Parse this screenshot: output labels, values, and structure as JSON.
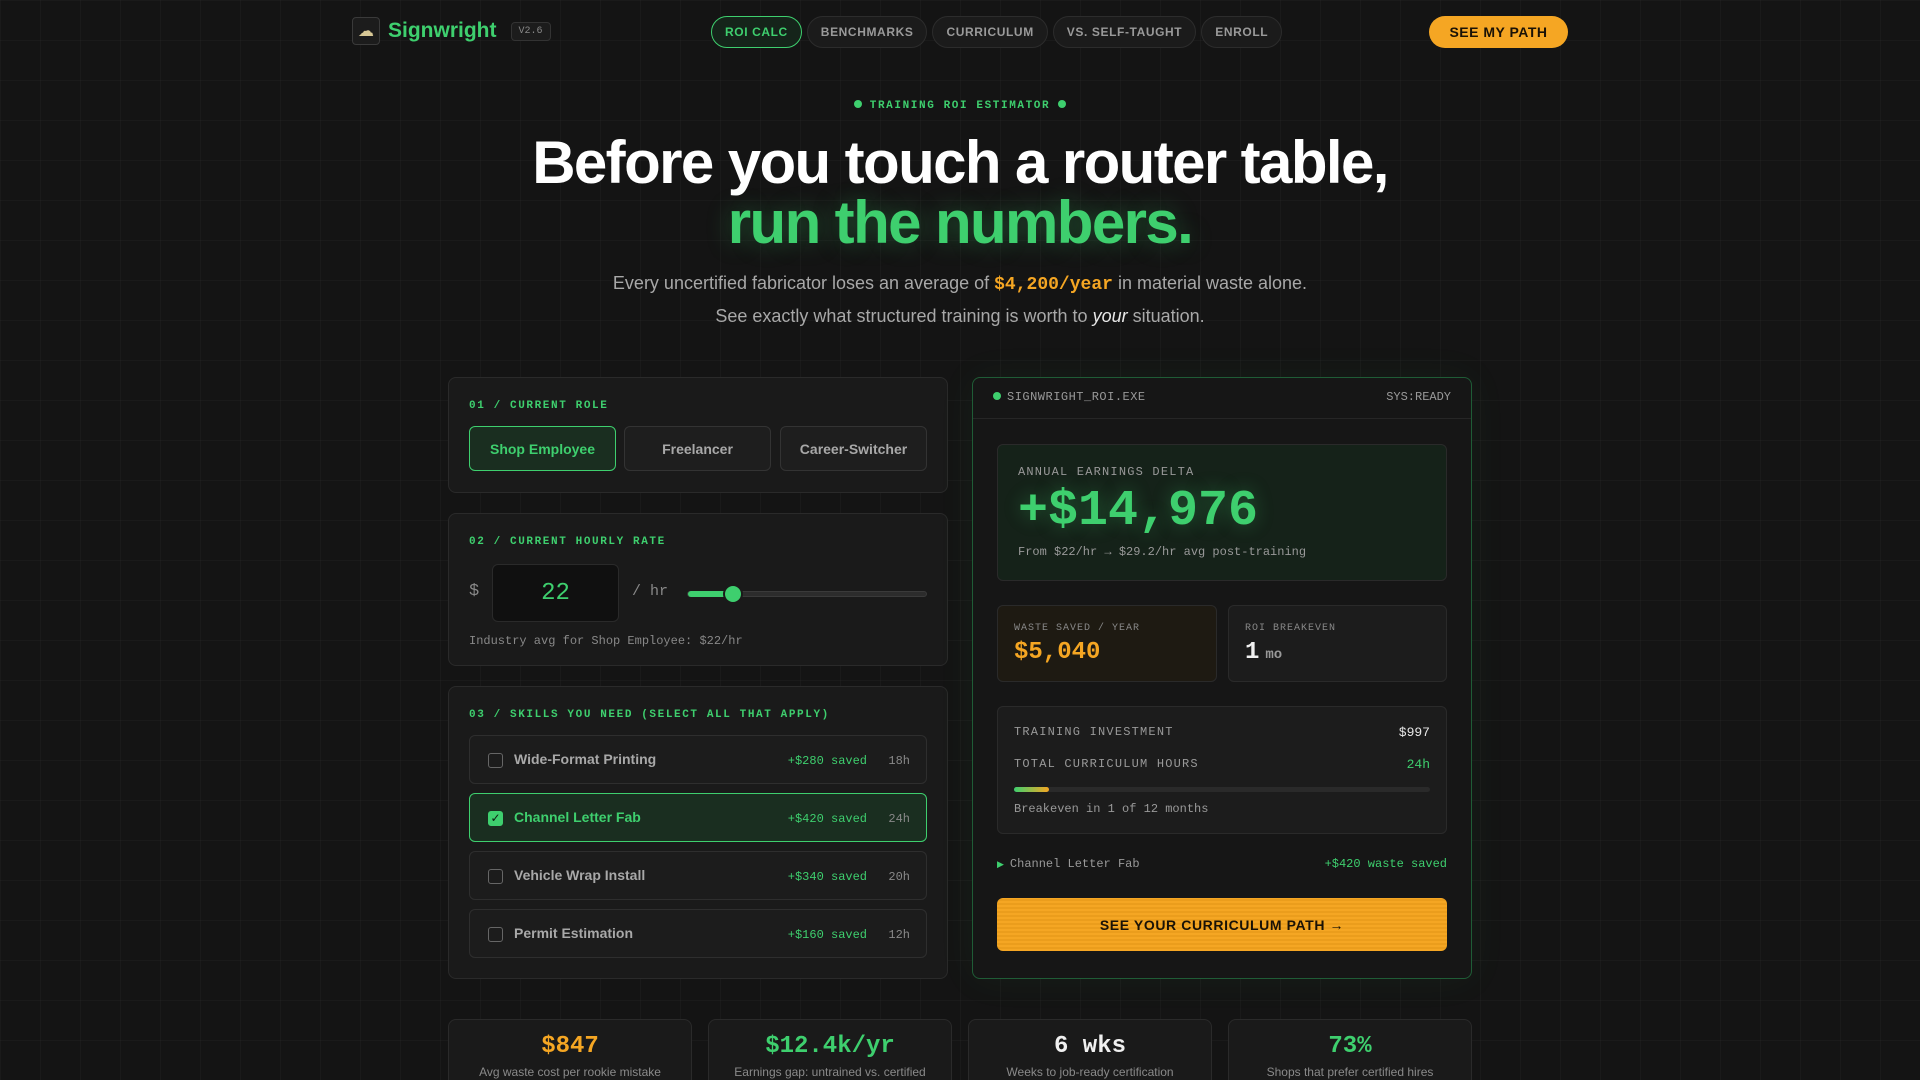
{
  "nav": {
    "brand": "Signwright",
    "version": "V2.6",
    "tabs": [
      "ROI CALC",
      "BENCHMARKS",
      "CURRICULUM",
      "VS. SELF-TAUGHT",
      "ENROLL"
    ],
    "cta": "SEE MY PATH"
  },
  "hero": {
    "eyebrow": "TRAINING ROI ESTIMATOR",
    "headline_1": "Before you touch a router table,",
    "headline_2": "run the numbers.",
    "sub_pre": "Every uncertified fabricator loses an average of ",
    "sub_highlight": "$4,200/year",
    "sub_mid": " in material waste alone. See exactly what structured training is worth to ",
    "sub_em": "your",
    "sub_post": " situation."
  },
  "role": {
    "label": "01 / CURRENT ROLE",
    "options": [
      "Shop Employee",
      "Freelancer",
      "Career-Switcher"
    ],
    "selected": "Shop Employee"
  },
  "rate": {
    "label": "02 / CURRENT HOURLY RATE",
    "currency": "$",
    "value": "22",
    "unit": "/ hr",
    "slider_fraction": 0.19,
    "note": "Industry avg for Shop Employee: $22/hr"
  },
  "skills": {
    "label": "03 / SKILLS YOU NEED (SELECT ALL THAT APPLY)",
    "items": [
      {
        "name": "Wide-Format Printing",
        "saved": "+$280 saved",
        "hours": "18h",
        "checked": false
      },
      {
        "name": "Channel Letter Fab",
        "saved": "+$420 saved",
        "hours": "24h",
        "checked": true
      },
      {
        "name": "Vehicle Wrap Install",
        "saved": "+$340 saved",
        "hours": "20h",
        "checked": false
      },
      {
        "name": "Permit Estimation",
        "saved": "+$160 saved",
        "hours": "12h",
        "checked": false
      }
    ]
  },
  "terminal": {
    "title": "SIGNWRIGHT_ROI.EXE",
    "status": "SYS:READY",
    "delta_label": "ANNUAL EARNINGS DELTA",
    "delta_value": "+$14,976",
    "delta_sub": "From $22/hr → $29.2/hr avg post-training",
    "waste_label": "WASTE SAVED / YEAR",
    "waste_value": "$5,040",
    "breakeven_label": "ROI BREAKEVEN",
    "breakeven_value": "1",
    "breakeven_unit": "mo",
    "invest_label": "TRAINING INVESTMENT",
    "invest_value": "$997",
    "hours_label": "TOTAL CURRICULUM HOURS",
    "hours_value": "24h",
    "breakeven_fraction": 0.083,
    "breakeven_note": "Breakeven in 1 of 12 months",
    "selected_skill": "Channel Letter Fab",
    "selected_saved": "+$420 waste saved",
    "cta": "SEE YOUR CURRICULUM PATH →"
  },
  "stats": [
    {
      "value": "$847",
      "label": "Avg waste cost per rookie mistake",
      "color": "#f5a623"
    },
    {
      "value": "$12.4k/yr",
      "label": "Earnings gap: untrained vs. certified",
      "color": "#3ecf6e"
    },
    {
      "value": "6 wks",
      "label": "Weeks to job-ready certification",
      "color": "#f0f0f0"
    },
    {
      "value": "73%",
      "label": "Shops that prefer certified hires",
      "color": "#3ecf6e"
    }
  ],
  "colors": {
    "accent_green": "#3ecf6e",
    "accent_amber": "#f5a623",
    "background": "#141414"
  }
}
